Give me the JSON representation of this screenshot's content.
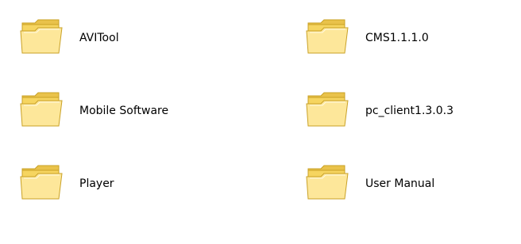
{
  "folders": [
    {
      "name": "AVITool",
      "icon": "folder-icon"
    },
    {
      "name": "CMS1.1.1.0",
      "icon": "folder-icon"
    },
    {
      "name": "Mobile Software",
      "icon": "folder-icon"
    },
    {
      "name": "pc_client1.3.0.3",
      "icon": "folder-icon"
    },
    {
      "name": "Player",
      "icon": "folder-icon"
    },
    {
      "name": "User Manual",
      "icon": "folder-icon"
    }
  ],
  "colors": {
    "background": "#ffffff",
    "folder_body": "#f6d560",
    "folder_edge": "#c9a126",
    "folder_front": "#fde79a"
  }
}
